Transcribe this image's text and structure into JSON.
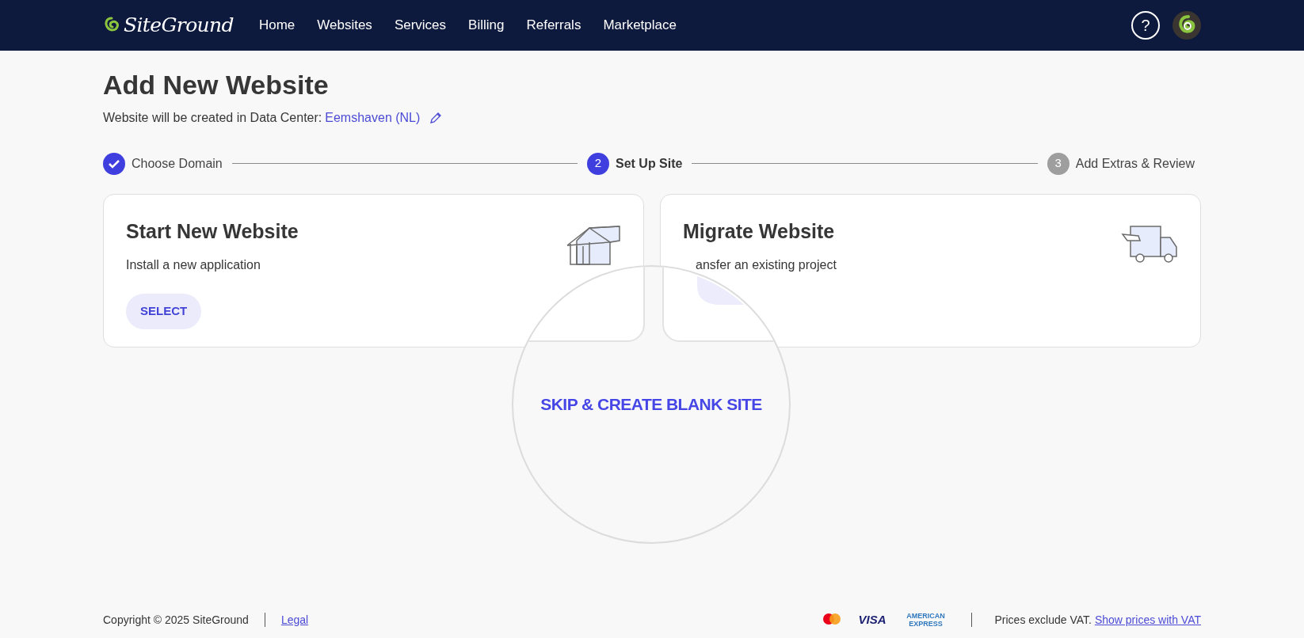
{
  "topbar": {
    "logo": "SiteGround",
    "nav": [
      "Home",
      "Websites",
      "Services",
      "Billing",
      "Referrals",
      "Marketplace"
    ],
    "help": "?"
  },
  "page": {
    "title": "Add New Website",
    "subtitle": "Website will be created in Data Center:",
    "data_center": "Eemshaven (NL)"
  },
  "steps": [
    {
      "label": "Choose Domain",
      "completed": true,
      "selected": false
    },
    {
      "label": "Set Up Site",
      "number": "2",
      "completed": false,
      "selected": true
    },
    {
      "label": "Add Extras & Review",
      "number": "3",
      "completed": false,
      "selected": false
    }
  ],
  "cards": [
    {
      "kind": "house",
      "title": "Start New Website",
      "description": "Install a new application",
      "button": "SELECT"
    },
    {
      "kind": "truck",
      "title": "Migrate Website",
      "description": "ansfer an existing project"
    }
  ],
  "magnifier": {
    "link": "SKIP & CREATE BLANK SITE"
  },
  "footer": {
    "copyright": "Copyright © 2025 SiteGround",
    "legal": "Legal",
    "payment_logos": [
      {
        "kind": "mastercard"
      },
      {
        "kind": "visa",
        "text": "VISA"
      },
      {
        "kind": "amex",
        "text": "AMERICAN EXPRESS"
      }
    ],
    "vat_note": "Prices exclude VAT.",
    "vat_link": "Show prices with VAT"
  }
}
